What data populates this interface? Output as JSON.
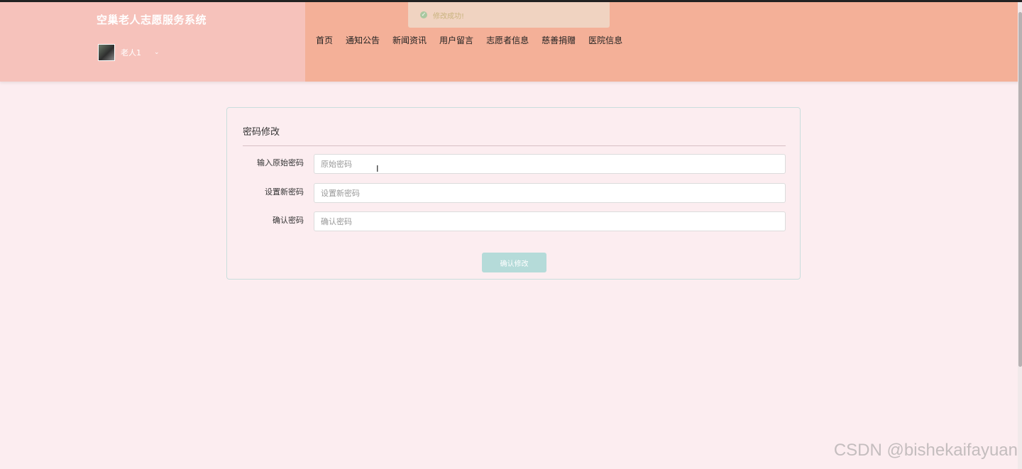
{
  "app": {
    "title": "空巢老人志愿服务系统"
  },
  "user": {
    "name": "老人1",
    "caret": "⌄"
  },
  "nav": {
    "items": [
      "首页",
      "通知公告",
      "新闻资讯",
      "用户留言",
      "志愿者信息",
      "慈善捐赠",
      "医院信息"
    ]
  },
  "toast": {
    "icon": "check-circle-icon",
    "text": "修改成功!"
  },
  "card": {
    "title": "密码修改"
  },
  "form": {
    "old_password": {
      "label": "输入原始密码",
      "placeholder": "原始密码",
      "value": ""
    },
    "new_password": {
      "label": "设置新密码",
      "placeholder": "设置新密码",
      "value": ""
    },
    "confirm_password": {
      "label": "确认密码",
      "placeholder": "确认密码",
      "value": ""
    },
    "submit_label": "确认修改"
  },
  "watermark": {
    "text": "CSDN @bishekaifayuan"
  },
  "colors": {
    "header_bg": "#f4b098",
    "brand_bg": "#f6c2bb",
    "page_bg": "#fcedf0",
    "button_bg": "#b5dbd9"
  }
}
